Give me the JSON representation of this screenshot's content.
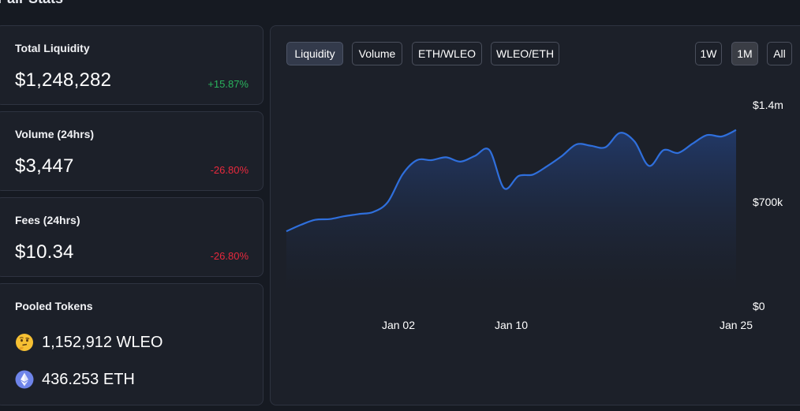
{
  "page": {
    "heading": "Pair Stats"
  },
  "cards": {
    "liquidity": {
      "label": "Total Liquidity",
      "value": "$1,248,282",
      "change": "+15.87%"
    },
    "volume": {
      "label": "Volume (24hrs)",
      "value": "$3,447",
      "change": "-26.80%"
    },
    "fees": {
      "label": "Fees (24hrs)",
      "value": "$10.34",
      "change": "-26.80%"
    },
    "pooled": {
      "label": "Pooled Tokens",
      "tokens": [
        {
          "icon": "thinking-face-icon",
          "amount": "1,152,912 WLEO"
        },
        {
          "icon": "ethereum-icon",
          "amount": "436.253 ETH"
        }
      ]
    }
  },
  "chart_tabs": [
    "Liquidity",
    "Volume",
    "ETH/WLEO",
    "WLEO/ETH"
  ],
  "range_tabs": [
    "1W",
    "1M",
    "All"
  ],
  "colors": {
    "up": "#2ab35d",
    "down": "#e8293d",
    "line": "#2f6fdc"
  },
  "chart_data": {
    "type": "area",
    "title": "",
    "xlabel": "",
    "ylabel": "",
    "ylim": [
      0,
      1400000
    ],
    "y_ticks": [
      "$0",
      "$700k",
      "$1.4m"
    ],
    "x_ticks": [
      "Jan 02",
      "Jan 10",
      "Jan 25"
    ],
    "x": [
      -6,
      -5,
      -4,
      -3,
      -2,
      -1,
      0,
      1,
      2,
      3,
      4,
      5,
      6,
      7,
      8,
      9,
      10,
      11,
      12,
      13,
      14,
      15,
      16,
      17,
      18,
      19,
      20,
      21,
      22,
      23,
      24,
      25
    ],
    "series": [
      {
        "values": [
          515000,
          560000,
          595000,
          600000,
          620000,
          635000,
          650000,
          720000,
          910000,
          1010000,
          1010000,
          1030000,
          1000000,
          1040000,
          1080000,
          815000,
          900000,
          910000,
          970000,
          1040000,
          1120000,
          1110000,
          1100000,
          1200000,
          1140000,
          970000,
          1080000,
          1060000,
          1125000,
          1185000,
          1175000,
          1220000
        ]
      }
    ]
  }
}
